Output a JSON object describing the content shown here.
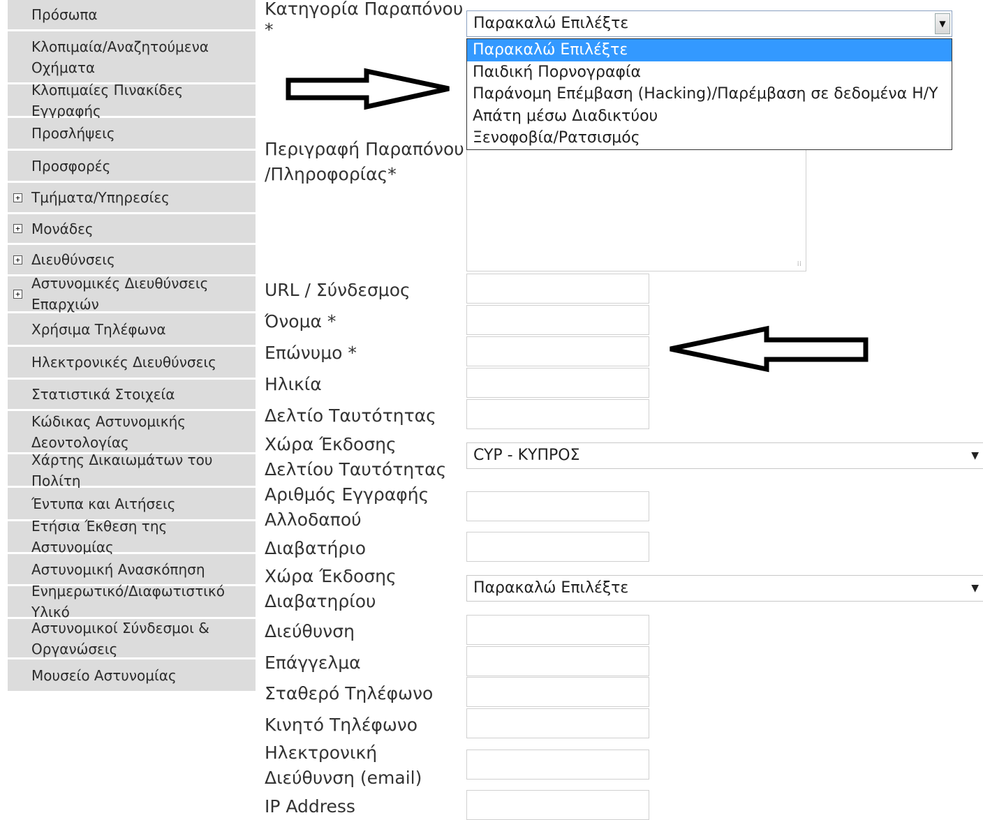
{
  "sidebar": {
    "items": [
      {
        "label": "Πρόσωπα",
        "expandable": false
      },
      {
        "label": "Κλοπιμαία/Αναζητούμενα Οχήματα",
        "expandable": false
      },
      {
        "label": "Κλοπιμαίες Πινακίδες Εγγραφής",
        "expandable": false
      },
      {
        "label": "Προσλήψεις",
        "expandable": false
      },
      {
        "label": "Προσφορές",
        "expandable": false
      },
      {
        "label": "Τμήματα/Υπηρεσίες",
        "expandable": true
      },
      {
        "label": "Μονάδες",
        "expandable": true
      },
      {
        "label": "Διευθύνσεις",
        "expandable": true
      },
      {
        "label": "Αστυνομικές Διευθύνσεις Επαρχιών",
        "expandable": true
      },
      {
        "label": "Χρήσιμα Τηλέφωνα",
        "expandable": false
      },
      {
        "label": "Ηλεκτρονικές Διευθύνσεις",
        "expandable": false
      },
      {
        "label": "Στατιστικά Στοιχεία",
        "expandable": false
      },
      {
        "label": "Κώδικας Αστυνομικής Δεοντολογίας",
        "expandable": false
      },
      {
        "label": "Χάρτης Δικαιωμάτων του Πολίτη",
        "expandable": false
      },
      {
        "label": "Έντυπα και Αιτήσεις",
        "expandable": false
      },
      {
        "label": "Ετήσια Έκθεση της Αστυνομίας",
        "expandable": false
      },
      {
        "label": "Αστυνομική Ανασκόπηση",
        "expandable": false
      },
      {
        "label": "Ενημερωτικό/Διαφωτιστικό Υλικό",
        "expandable": false
      },
      {
        "label": "Αστυνομικοί Σύνδεσμοι & Οργανώσεις",
        "expandable": false
      },
      {
        "label": "Μουσείο Αστυνομίας",
        "expandable": false
      }
    ],
    "expand_icon": "+"
  },
  "form": {
    "category_label": "Κατηγορία Παραπόνου",
    "category_required": "*",
    "category_value": "Παρακαλώ Επιλέξτε",
    "category_options": [
      "Παρακαλώ Επιλέξτε",
      "Παιδική Πορνογραφία",
      "Παράνομη Επέμβαση (Hacking)/Παρέμβαση σε δεδομένα Η/Υ",
      "Απάτη μέσω Διαδικτύου",
      "Ξενοφοβία/Ρατσισμός"
    ],
    "description_label": "Περιγραφή Παραπόνου /Πληροφορίας*",
    "url_label": "URL / Σύνδεσμος",
    "name_label": "Όνομα *",
    "surname_label": "Επώνυμο *",
    "age_label": "Ηλικία",
    "id_card_label": "Δελτίο Ταυτότητας",
    "id_country_label": "Χώρα Έκδοσης Δελτίου Ταυτότητας",
    "id_country_value": "CYP - ΚΥΠΡΟΣ",
    "alien_reg_label": "Αριθμός Εγγραφής Αλλοδαπού",
    "passport_label": "Διαβατήριο",
    "passport_country_label": "Χώρα Έκδοσης Διαβατηρίου",
    "passport_country_value": "Παρακαλώ Επιλέξτε",
    "address_label": "Διεύθυνση",
    "profession_label": "Επάγγελμα",
    "landline_label": "Σταθερό Τηλέφωνο",
    "mobile_label": "Κινητό Τηλέφωνο",
    "email_label": "Ηλεκτρονική Διεύθυνση (email)",
    "ip_label": "IP Address",
    "dropdown_arrow": "▼"
  }
}
